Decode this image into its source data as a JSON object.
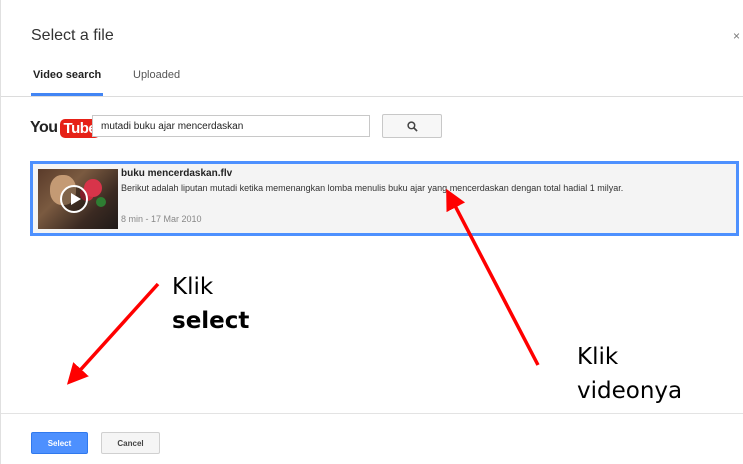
{
  "dialog": {
    "title": "Select a file",
    "close_glyph": "×"
  },
  "tabs": [
    {
      "label": "Video search",
      "active": true
    },
    {
      "label": "Uploaded",
      "active": false
    }
  ],
  "search": {
    "logo_you": "You",
    "logo_tube": "Tube",
    "query": "mutadi buku ajar mencerdaskan",
    "button_icon": "search-icon"
  },
  "results": [
    {
      "title": "buku mencerdaskan.flv",
      "description": "Berikut adalah liputan mutadi ketika memenangkan lomba menulis buku ajar yang mencerdaskan dengan total hadial 1 milyar.",
      "meta": "8 min - 17 Mar 2010",
      "selected": true
    }
  ],
  "footer": {
    "select_label": "Select",
    "cancel_label": "Cancel"
  },
  "annotations": {
    "left_line1": "Klik",
    "left_line2": "select",
    "right_line1": "Klik",
    "right_line2": "videonya",
    "arrow_color": "#ff0000"
  },
  "colors": {
    "accent": "#4d90fe",
    "youtube_red": "#e62117"
  }
}
